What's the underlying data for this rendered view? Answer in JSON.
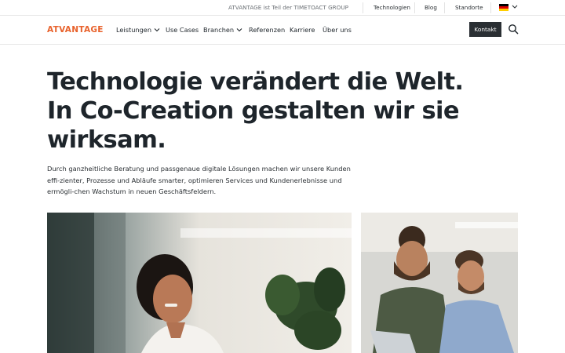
{
  "topbar": {
    "group_note": "ATVANTAGE ist Teil der TIMETOACT GROUP",
    "links": [
      "Technologien",
      "Blog",
      "Standorte"
    ],
    "language_flag": "german-flag-icon"
  },
  "nav": {
    "logo": "ATVANTAGE",
    "items": [
      "Leistungen",
      "Use Cases",
      "Branchen",
      "Referenzen",
      "Karriere",
      "Über uns"
    ],
    "contact_button": "Kontakt"
  },
  "hero": {
    "title": "Technologie verändert die Welt. In Co-Creation gestalten wir sie wirksam.",
    "text": "Durch ganzheitliche Beratung und passgenaue digitale Lösungen machen wir unsere Kunden effi-zienter, Prozesse und Abläufe smarter, optimieren Services und Kundenerlebnisse und ermögli-chen Wachstum in neuen Geschäftsfeldern."
  },
  "colors": {
    "brand": "#e8622c",
    "text": "#1e252b",
    "button_bg": "#2a2f33"
  }
}
